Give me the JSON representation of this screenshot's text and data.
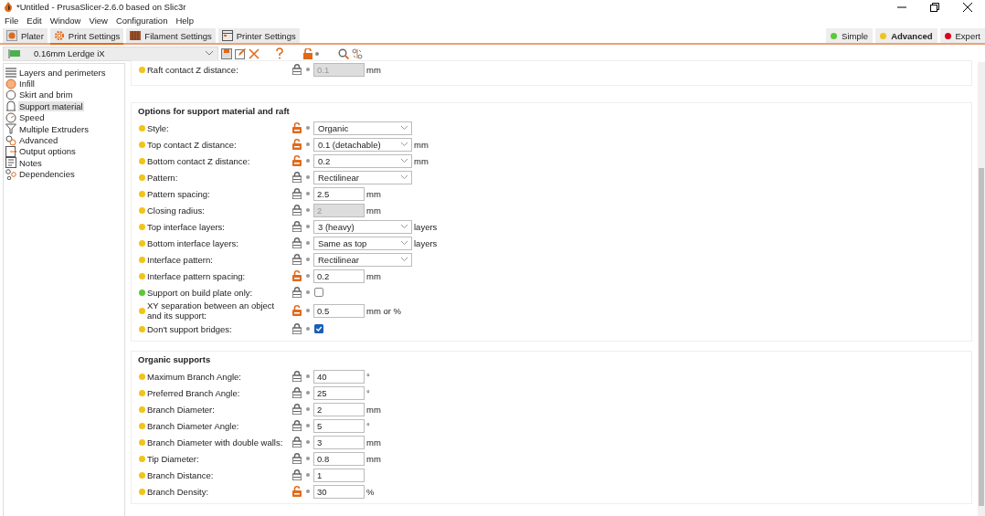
{
  "window": {
    "title": "*Untitled - PrusaSlicer-2.6.0 based on Slic3r"
  },
  "menu": [
    "File",
    "Edit",
    "Window",
    "View",
    "Configuration",
    "Help"
  ],
  "tabs": [
    {
      "label": "Plater",
      "selected": false
    },
    {
      "label": "Print Settings",
      "selected": true
    },
    {
      "label": "Filament Settings",
      "selected": false
    },
    {
      "label": "Printer Settings",
      "selected": false
    }
  ],
  "modes": [
    {
      "label": "Simple",
      "color": "#5ec73a",
      "selected": false
    },
    {
      "label": "Advanced",
      "color": "#f0c419",
      "selected": true
    },
    {
      "label": "Expert",
      "color": "#d9001b",
      "selected": false
    }
  ],
  "preset": {
    "value": "0.16mm Lerdge iX"
  },
  "sidebar": {
    "items": [
      {
        "label": "Layers and perimeters",
        "selected": false
      },
      {
        "label": "Infill",
        "selected": false
      },
      {
        "label": "Skirt and brim",
        "selected": false
      },
      {
        "label": "Support material",
        "selected": true
      },
      {
        "label": "Speed",
        "selected": false
      },
      {
        "label": "Multiple Extruders",
        "selected": false
      },
      {
        "label": "Advanced",
        "selected": false
      },
      {
        "label": "Output options",
        "selected": false
      },
      {
        "label": "Notes",
        "selected": false
      },
      {
        "label": "Dependencies",
        "selected": false
      }
    ]
  },
  "sections": [
    {
      "rows": [
        {
          "label": "Raft contact Z distance:",
          "color": "#f0c419",
          "locked": true,
          "control": {
            "kind": "text",
            "value": "0.1",
            "disabled": true
          },
          "unit": "mm"
        }
      ]
    },
    {
      "title": "Options for support material and raft",
      "rows": [
        {
          "label": "Style:",
          "color": "#f0c419",
          "locked": false,
          "control": {
            "kind": "combo",
            "value": "Organic",
            "disabled": false
          }
        },
        {
          "label": "Top contact Z distance:",
          "color": "#f0c419",
          "locked": false,
          "control": {
            "kind": "combo",
            "value": "0.1 (detachable)",
            "disabled": false
          },
          "unit": "mm"
        },
        {
          "label": "Bottom contact Z distance:",
          "color": "#f0c419",
          "locked": false,
          "control": {
            "kind": "combo",
            "value": "0.2",
            "disabled": false
          },
          "unit": "mm"
        },
        {
          "label": "Pattern:",
          "color": "#f0c419",
          "locked": true,
          "control": {
            "kind": "combo",
            "value": "Rectilinear",
            "disabled": false
          }
        },
        {
          "label": "Pattern spacing:",
          "color": "#f0c419",
          "locked": true,
          "control": {
            "kind": "text",
            "value": "2.5",
            "disabled": false
          },
          "unit": "mm"
        },
        {
          "label": "Closing radius:",
          "color": "#f0c419",
          "locked": true,
          "control": {
            "kind": "text",
            "value": "2",
            "disabled": true
          },
          "unit": "mm"
        },
        {
          "label": "Top interface layers:",
          "color": "#f0c419",
          "locked": true,
          "control": {
            "kind": "combo",
            "value": "3 (heavy)",
            "disabled": false
          },
          "unit": "layers"
        },
        {
          "label": "Bottom interface layers:",
          "color": "#f0c419",
          "locked": true,
          "control": {
            "kind": "combo",
            "value": "Same as top",
            "disabled": false
          },
          "unit": "layers"
        },
        {
          "label": "Interface pattern:",
          "color": "#f0c419",
          "locked": true,
          "control": {
            "kind": "combo",
            "value": "Rectilinear",
            "disabled": false
          }
        },
        {
          "label": "Interface pattern spacing:",
          "color": "#f0c419",
          "locked": false,
          "control": {
            "kind": "text",
            "value": "0.2",
            "disabled": false
          },
          "unit": "mm"
        },
        {
          "label": "Support on build plate only:",
          "color": "#5ec73a",
          "locked": true,
          "control": {
            "kind": "checkbox",
            "checked": false
          }
        },
        {
          "label": "XY separation between an object and its support:",
          "color": "#f0c419",
          "locked": false,
          "control": {
            "kind": "text",
            "value": "0.5",
            "disabled": false
          },
          "unit": "mm or %"
        },
        {
          "label": "Don't support bridges:",
          "color": "#f0c419",
          "locked": true,
          "control": {
            "kind": "checkbox",
            "checked": true
          }
        }
      ]
    },
    {
      "title": "Organic supports",
      "rows": [
        {
          "label": "Maximum Branch Angle:",
          "color": "#f0c419",
          "locked": true,
          "control": {
            "kind": "text",
            "value": "40",
            "disabled": false
          },
          "unit": "°"
        },
        {
          "label": "Preferred Branch Angle:",
          "color": "#f0c419",
          "locked": true,
          "control": {
            "kind": "text",
            "value": "25",
            "disabled": false
          },
          "unit": "°"
        },
        {
          "label": "Branch Diameter:",
          "color": "#f0c419",
          "locked": true,
          "control": {
            "kind": "text",
            "value": "2",
            "disabled": false
          },
          "unit": "mm"
        },
        {
          "label": "Branch Diameter Angle:",
          "color": "#f0c419",
          "locked": true,
          "control": {
            "kind": "text",
            "value": "5",
            "disabled": false
          },
          "unit": "°"
        },
        {
          "label": "Branch Diameter with double walls:",
          "color": "#f0c419",
          "locked": true,
          "control": {
            "kind": "text",
            "value": "3",
            "disabled": false
          },
          "unit": "mm"
        },
        {
          "label": "Tip Diameter:",
          "color": "#f0c419",
          "locked": true,
          "control": {
            "kind": "text",
            "value": "0.8",
            "disabled": false
          },
          "unit": "mm"
        },
        {
          "label": "Branch Distance:",
          "color": "#f0c419",
          "locked": true,
          "control": {
            "kind": "text",
            "value": "1",
            "disabled": false
          }
        },
        {
          "label": "Branch Density:",
          "color": "#f0c419",
          "locked": false,
          "control": {
            "kind": "text",
            "value": "30",
            "disabled": false
          },
          "unit": "%"
        }
      ]
    }
  ]
}
